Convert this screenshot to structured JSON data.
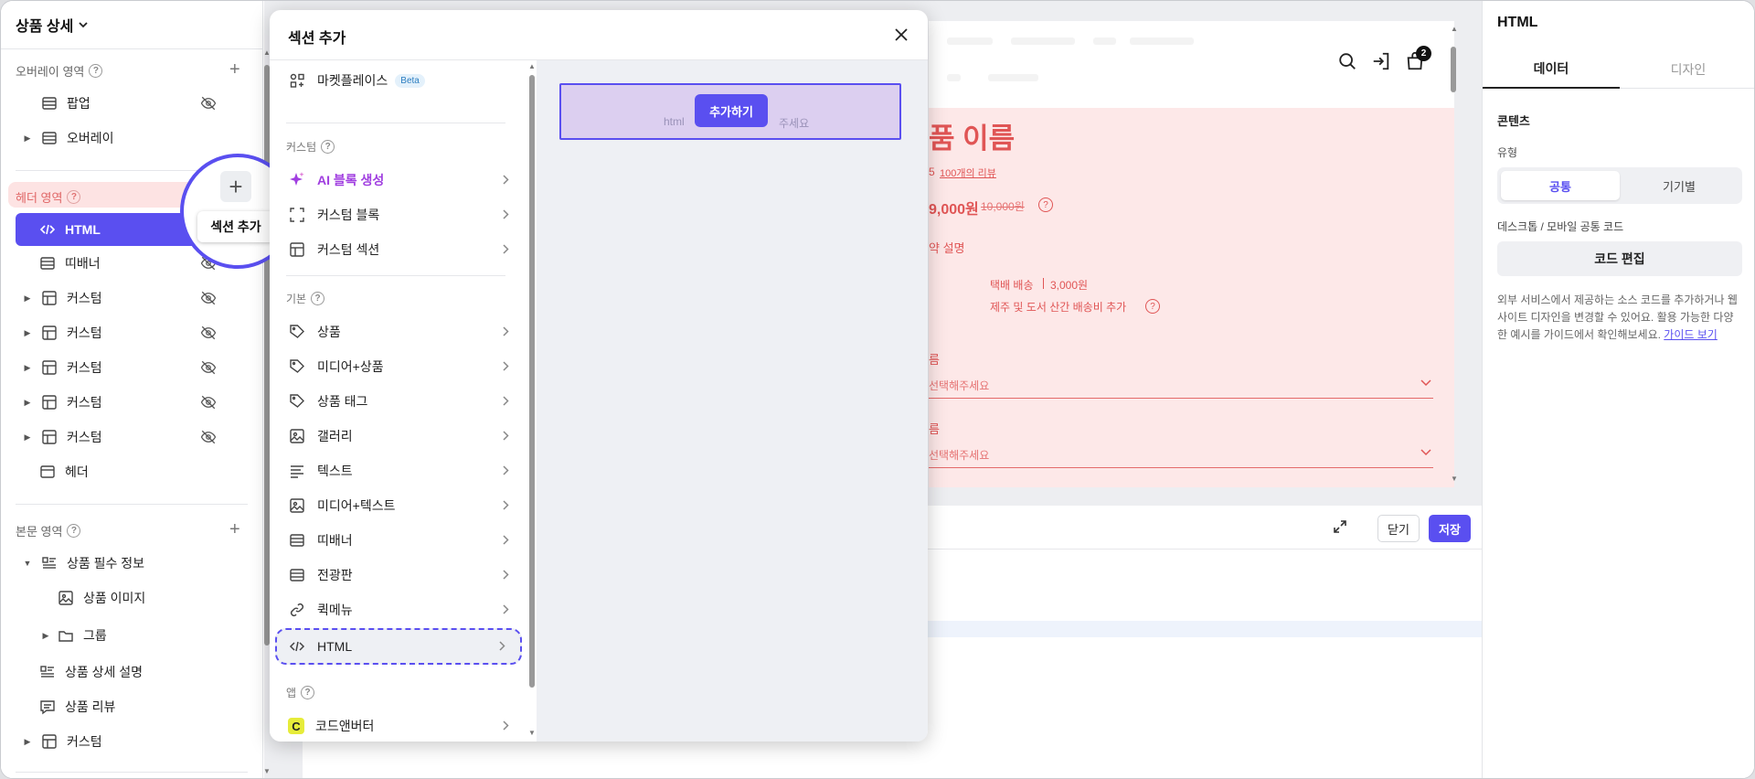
{
  "left": {
    "title": "상품 상세",
    "overlay_label": "오버레이 영역",
    "overlay_items": [
      "팝업",
      "오버레이"
    ],
    "header_label": "헤더 영역",
    "header_items": [
      "HTML",
      "띠배너",
      "커스텀",
      "커스텀",
      "커스텀",
      "커스텀",
      "커스텀",
      "헤더"
    ],
    "body_label": "본문 영역",
    "body_items": [
      "상품 필수 정보",
      "상품 이미지",
      "그룹",
      "상품 상세 설명",
      "상품 리뷰",
      "커스텀"
    ]
  },
  "callout": {
    "label": "섹션 추가"
  },
  "modal": {
    "title": "섹션 추가",
    "marketplace": "마켓플레이스",
    "beta": "Beta",
    "custom_label": "커스텀",
    "custom_items": [
      "AI 블록 생성",
      "커스텀 블록",
      "커스텀 섹션"
    ],
    "basic_label": "기본",
    "basic_items": [
      "상품",
      "미디어+상품",
      "상품 태그",
      "갤러리",
      "텍스트",
      "미디어+텍스트",
      "띠배너",
      "전광판",
      "퀵메뉴",
      "HTML"
    ],
    "app_label": "앱",
    "app_items": [
      "코드앤버터"
    ],
    "app_badge": "C",
    "preview_left_text": "html",
    "preview_right_text": "주세요",
    "add_button": "추가하기"
  },
  "preview": {
    "cart_count": "2",
    "product_name": "품 이름",
    "rating_num": "5",
    "review_link": "100개의 리뷰",
    "price": "9,000원",
    "old_price": "10,000원",
    "short_desc": "약 설명",
    "shipping": "택배 배송",
    "shipping_fee": "3,000원",
    "shipping_extra": "제주 및 도서 산간 배송비 추가",
    "option1_label": "름",
    "option1_placeholder": "선택해주세요",
    "option2_label": "름",
    "option2_placeholder": "선택해주세요"
  },
  "bottom": {
    "close_label": "닫기",
    "save_label": "저장"
  },
  "right": {
    "title": "HTML",
    "tabs": [
      "데이터",
      "디자인"
    ],
    "content_label": "콘텐츠",
    "type_label": "유형",
    "type_options": [
      "공통",
      "기기별"
    ],
    "code_label": "데스크톱 / 모바일 공통 코드",
    "edit_button": "코드 편집",
    "help_text": "외부 서비스에서 제공하는 소스 코드를 추가하거나 웹사이트 디자인을 변경할 수 있어요. 활용 가능한 다양한 예시를 가이드에서 확인해보세요.",
    "guide_link": "가이드 보기"
  },
  "colors": {
    "accent": "#5a4ff0",
    "preview_bg": "#fde8e8",
    "preview_text": "#e05555",
    "ai_purple": "#a03ee0"
  }
}
